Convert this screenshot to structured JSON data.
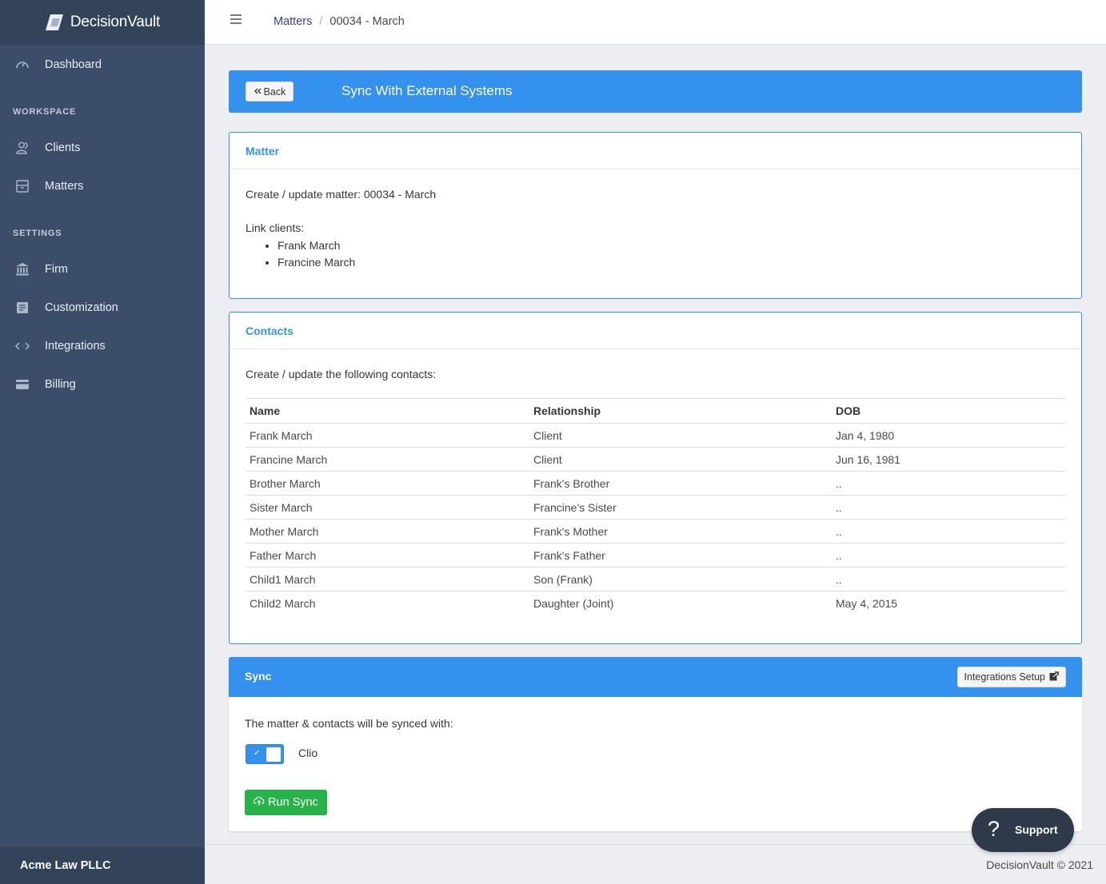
{
  "brand": {
    "name": "DecisionVault"
  },
  "sidebar": {
    "items": [
      {
        "label": "Dashboard",
        "icon": "gauge-icon"
      },
      {
        "label": "Clients",
        "icon": "users-icon"
      },
      {
        "label": "Matters",
        "icon": "archive-icon"
      },
      {
        "label": "Firm",
        "icon": "bank-icon"
      },
      {
        "label": "Customization",
        "icon": "list-icon"
      },
      {
        "label": "Integrations",
        "icon": "code-icon"
      },
      {
        "label": "Billing",
        "icon": "credit-card-icon"
      }
    ],
    "sections": {
      "workspace": "WORKSPACE",
      "settings": "SETTINGS"
    },
    "footer": "Acme Law PLLC"
  },
  "breadcrumb": {
    "root": "Matters",
    "sep": "/",
    "current": "00034 - March"
  },
  "banner": {
    "back_label": "Back",
    "title": "Sync With External Systems"
  },
  "matter_card": {
    "title": "Matter",
    "line": "Create / update matter: 00034 - March",
    "link_label": "Link clients:",
    "clients": [
      "Frank March",
      "Francine March"
    ]
  },
  "contacts_card": {
    "title": "Contacts",
    "intro": "Create / update the following contacts:",
    "headers": {
      "name": "Name",
      "relationship": "Relationship",
      "dob": "DOB"
    },
    "rows": [
      {
        "name": "Frank March",
        "relationship": "Client",
        "dob": "Jan 4, 1980"
      },
      {
        "name": "Francine March",
        "relationship": "Client",
        "dob": "Jun 16, 1981"
      },
      {
        "name": "Brother March",
        "relationship": "Frank's Brother",
        "dob": ".."
      },
      {
        "name": "Sister March",
        "relationship": "Francine's Sister",
        "dob": ".."
      },
      {
        "name": "Mother March",
        "relationship": "Frank's Mother",
        "dob": ".."
      },
      {
        "name": "Father March",
        "relationship": "Frank's Father",
        "dob": ".."
      },
      {
        "name": "Child1 March",
        "relationship": "Son (Frank)",
        "dob": ".."
      },
      {
        "name": "Child2 March",
        "relationship": "Daughter (Joint)",
        "dob": "May 4, 2015"
      }
    ]
  },
  "sync_card": {
    "title": "Sync",
    "setup_label": "Integrations Setup",
    "intro": "The matter & contacts will be synced with:",
    "integration": "Clio",
    "integration_enabled": true,
    "run_label": "Run Sync"
  },
  "footer": {
    "copyright": "DecisionVault © 2021"
  },
  "support": {
    "label": "Support"
  },
  "colors": {
    "primary": "#3491ee",
    "sidebar": "#3b4d68",
    "success": "#27b24a"
  }
}
